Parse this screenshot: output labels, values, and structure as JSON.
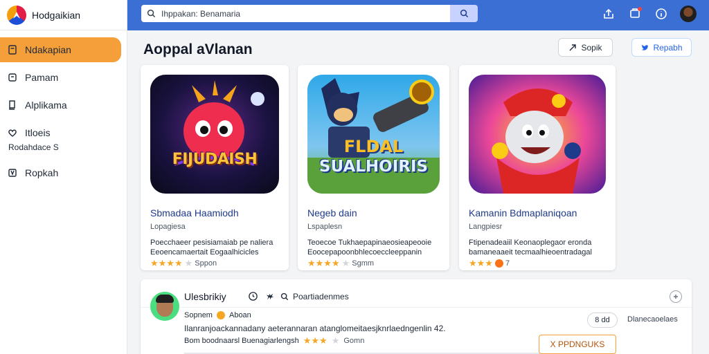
{
  "app": {
    "name": "Hodgaikian"
  },
  "sidebar": {
    "items": [
      {
        "label": "Ndakapian",
        "icon": "document-icon",
        "active": true
      },
      {
        "label": "Pamam",
        "icon": "square-icon"
      },
      {
        "label": "Alplikama",
        "icon": "book-icon"
      },
      {
        "label": "Itloeis",
        "icon": "heart-icon"
      },
      {
        "label": "Ropkah",
        "icon": "bookmark-icon"
      }
    ],
    "sub_label": "Rodahdace S"
  },
  "header": {
    "search_placeholder": "Ihppakan: Benamaria",
    "colors": {
      "bar": "#3b6fd4",
      "accent": "#f59f3a"
    }
  },
  "main": {
    "title": "Aoppal aVlanan",
    "share_label": "Sopik",
    "report_label": "Repabh",
    "cards": [
      {
        "title": "Sbmadaa Haamiodh",
        "developer": "Lopagiesa",
        "desc_line1": "Poecchaeer pesisiamaiab pe naliera",
        "desc_line2": "Eeoencamaertait Eogaalhicicles",
        "stars": "★★★★",
        "rating_text": "Sppon",
        "art_text": "FIJUDAISH"
      },
      {
        "title": "Negeb dain",
        "developer": "Lspaplesn",
        "desc_line1": "Teoecoe Tukhaepapinaeosieapeooie",
        "desc_line2": "Eoocepapoonbhlecoeccleeppanin",
        "stars": "★★★★",
        "rating_text": "Sgmm",
        "art_text_1": "FLDAL",
        "art_text_2": "SUALHOIRIS"
      },
      {
        "title": "Kamanin Bdmaplaniqoan",
        "developer": "Langpiesr",
        "desc_line1": "Ftipenadeaiil Keonaoplegaor eronda",
        "desc_line2": "bamaneaaeit tecmaalhieoentradagal",
        "stars": "★★★",
        "rating_text": "7"
      }
    ]
  },
  "review": {
    "name": "Ulesbrikiy",
    "search_label": "Poartiadenmes",
    "sub_label": "Sopnem",
    "sub_extra": "Aboan",
    "text": "Ilanranjoackannadany aeterannaran atanglomeitaesjknrlaedngenlin 42.",
    "meta_label": "Bom boodnaarsl Buenagiarlengsh",
    "stars": "★★★",
    "rating_text": "Gomn",
    "pill": "8 dd",
    "helpful_label": "Dlanecaoelaes",
    "action_label": "X PPDNGUKS"
  }
}
